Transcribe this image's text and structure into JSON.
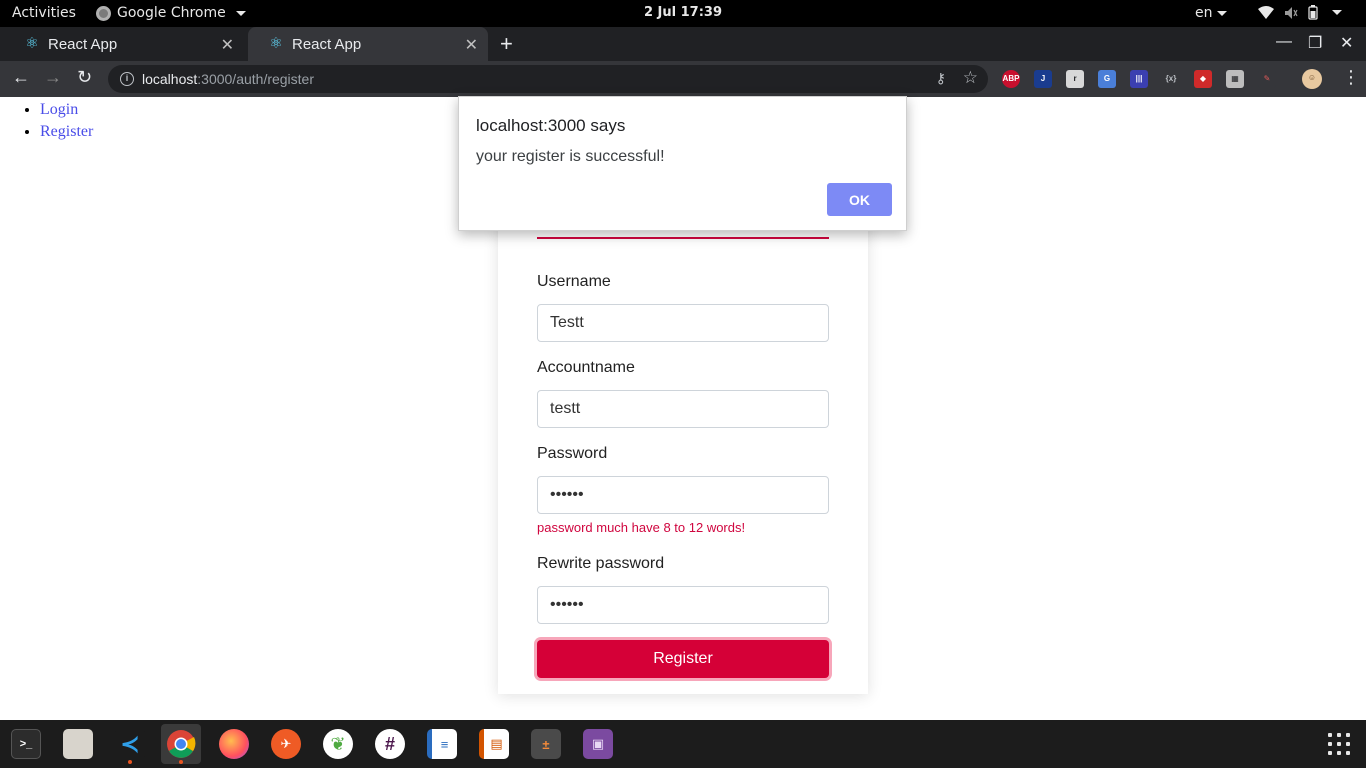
{
  "topbar": {
    "activities": "Activities",
    "app_name": "Google Chrome",
    "clock": "2 Jul  17:39",
    "language": "en"
  },
  "tabs": [
    {
      "title": "React App",
      "icon": "react-icon"
    },
    {
      "title": "React App",
      "icon": "react-icon"
    }
  ],
  "omnibox": {
    "host": "localhost",
    "path": ":3000/auth/register"
  },
  "nav": {
    "login": "Login",
    "register": "Register"
  },
  "form": {
    "username_label": "Username",
    "username_value": "Testt",
    "accountname_label": "Accountname",
    "accountname_value": "testt",
    "password_label": "Password",
    "password_value": "••••••",
    "password_error": "password much have 8 to 12 words!",
    "rewrite_label": "Rewrite password",
    "rewrite_value": "••••••",
    "submit_label": "Register"
  },
  "dialog": {
    "title": "localhost:3000 says",
    "message": "your register is successful!",
    "ok_label": "OK"
  },
  "extensions": {
    "abp": "ABP"
  },
  "colors": {
    "accent": "#d50037",
    "link": "#4a4de8",
    "ok_button": "#7d8af5"
  }
}
